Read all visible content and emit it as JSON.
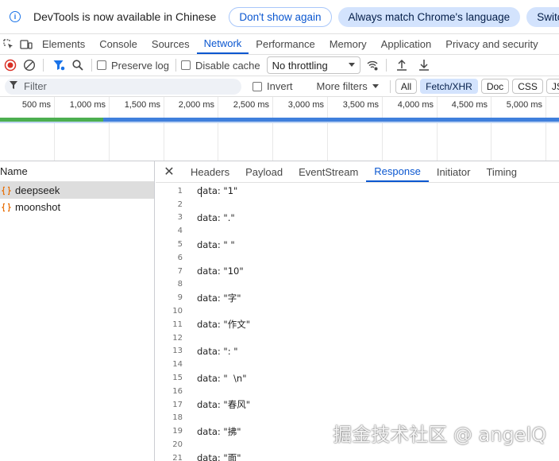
{
  "infobar": {
    "message": "DevTools is now available in Chinese",
    "dont_show_label": "Don't show again",
    "match_language_label": "Always match Chrome's language",
    "switch_label": "Switch D"
  },
  "tabs": [
    "Elements",
    "Console",
    "Sources",
    "Network",
    "Performance",
    "Memory",
    "Application",
    "Privacy and security"
  ],
  "active_tab": "Network",
  "toolbar": {
    "preserve_log_label": "Preserve log",
    "disable_cache_label": "Disable cache",
    "throttling_value": "No throttling"
  },
  "filterbar": {
    "filter_placeholder": "Filter",
    "invert_label": "Invert",
    "more_filters_label": "More filters",
    "chips": [
      "All",
      "Fetch/XHR",
      "Doc",
      "CSS",
      "JS"
    ],
    "active_chip": "Fetch/XHR"
  },
  "overview": {
    "ticks": [
      "500 ms",
      "1,000 ms",
      "1,500 ms",
      "2,000 ms",
      "2,500 ms",
      "3,000 ms",
      "3,500 ms",
      "4,000 ms",
      "4,500 ms",
      "5,000 ms"
    ]
  },
  "requests": {
    "header": "Name",
    "items": [
      {
        "name": "deepseek",
        "selected": true
      },
      {
        "name": "moonshot",
        "selected": false
      }
    ]
  },
  "detail": {
    "tabs": [
      "Headers",
      "Payload",
      "EventStream",
      "Response",
      "Initiator",
      "Timing"
    ],
    "active_tab": "Response",
    "lines": [
      {
        "n": "1",
        "text": "data: \"1\""
      },
      {
        "n": "2",
        "text": ""
      },
      {
        "n": "3",
        "text": "data: \".\""
      },
      {
        "n": "4",
        "text": ""
      },
      {
        "n": "5",
        "text": "data: \" \""
      },
      {
        "n": "6",
        "text": ""
      },
      {
        "n": "7",
        "text": "data: \"10\""
      },
      {
        "n": "8",
        "text": ""
      },
      {
        "n": "9",
        "text": "data: \"字\""
      },
      {
        "n": "10",
        "text": ""
      },
      {
        "n": "11",
        "text": "data: \"作文\""
      },
      {
        "n": "12",
        "text": ""
      },
      {
        "n": "13",
        "text": "data: \": \""
      },
      {
        "n": "14",
        "text": ""
      },
      {
        "n": "15",
        "text": "data: \"  \\n\""
      },
      {
        "n": "16",
        "text": ""
      },
      {
        "n": "17",
        "text": "data: \"春风\""
      },
      {
        "n": "18",
        "text": ""
      },
      {
        "n": "19",
        "text": "data: \"拂\""
      },
      {
        "n": "20",
        "text": ""
      },
      {
        "n": "21",
        "text": "data: \"面\""
      }
    ]
  },
  "watermark": "掘金技术社区 @ angelQ",
  "colors": {
    "accent": "#0b57d0",
    "record_red": "#d93025",
    "filter_blue": "#1a73e8",
    "green_bar": "#4caf50",
    "blue_bar": "#3f7fdc"
  }
}
